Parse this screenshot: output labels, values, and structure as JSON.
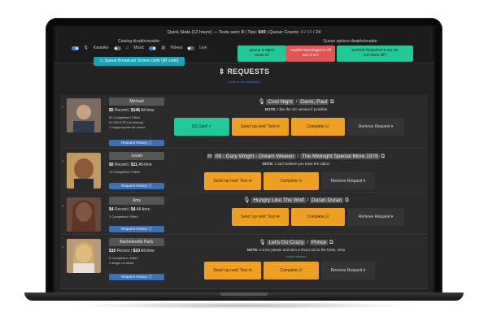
{
  "stats": {
    "prefix": "Quick Stats (12 hours) — Texts sent:",
    "texts": "0",
    "tips_label": "| Tips:",
    "tips": "$49",
    "queue_label": "| Queue Counts:",
    "c1": "4",
    "c2": "10",
    "c3": "24"
  },
  "catalog": {
    "label": "Catalog disable/enable:",
    "items": [
      "Karaoke",
      "Music",
      "Videos",
      "Live"
    ],
    "broadcast_btn": "Queue Broadcast Screen (with QR code)"
  },
  "queue_options": {
    "label": "Queue options disable/enable:",
    "open_line1": "Queue is Open",
    "open_line2": "Close it?",
    "warn_line1": "Explicit Warning(s) is Off",
    "warn_line2": "turn it on?",
    "super_line1": "SUPER REQUESTS are On",
    "super_line2": "turn them off?"
  },
  "page": {
    "title": "REQUESTS",
    "subtitle": "(click to see requests)"
  },
  "requests": [
    {
      "user": "Michael",
      "money": [
        "$5",
        "Recent",
        "$146",
        "All-time"
      ],
      "lines": [
        "52 Completed / Filled",
        "57 DELETE (no history)",
        "1 Inappropriate for venue"
      ],
      "history": "Request History",
      "song_title": "Cool Night",
      "artist": "Davis, Paul",
      "note_label": "NOTE:",
      "note": "I like the SC version if possible",
      "status_line": "",
      "buttons": [
        "SS Card",
        "Send 'up next' Text",
        "Complete",
        "Remove Request"
      ]
    },
    {
      "user": "Josiah",
      "money": [
        "$0",
        "Recent",
        "$11",
        "All-time"
      ],
      "lines": [
        "12 Completed / Filled"
      ],
      "history": "Request History",
      "song_title": "08 - Gary Wright - Dream Weaver",
      "artist": "The Midnight Special More 1976",
      "note_label": "NOTE:",
      "note": "I can't believe you have the video!",
      "status_line": "",
      "buttons": [
        "Send 'up next' Text",
        "Complete",
        "Remove Request"
      ]
    },
    {
      "user": "Amy",
      "money": [
        "$4",
        "Recent",
        "$4",
        "All-time"
      ],
      "lines": [
        "2 Completed / Filled"
      ],
      "history": "Request History",
      "song_title": "Hungry Like The Wolf",
      "artist": "Duran Duran",
      "note_label": "",
      "note": "",
      "status_line": "",
      "buttons": [
        "Send 'up next' Text",
        "Complete",
        "Remove Request"
      ]
    },
    {
      "user": "Bachelorette Party",
      "money": [
        "$10",
        "Recent",
        "$10",
        "All-time"
      ],
      "lines": [
        "0 Completed / Filled",
        "1 singer on show"
      ],
      "history": "Request History",
      "song_title": "Let's Go Crazy",
      "artist": "Prince",
      "note_label": "NOTE:",
      "note": "3 mics please and also a shout out to the bride, Gina",
      "status_line": "in the rotation",
      "buttons": [
        "Send 'up next' Text",
        "Complete",
        "Remove Request"
      ]
    }
  ],
  "colors": {
    "green": "#20c997",
    "orange": "#f0a020",
    "red": "#e55353",
    "teal": "#17a2b8",
    "blue": "#3b6fb6"
  }
}
